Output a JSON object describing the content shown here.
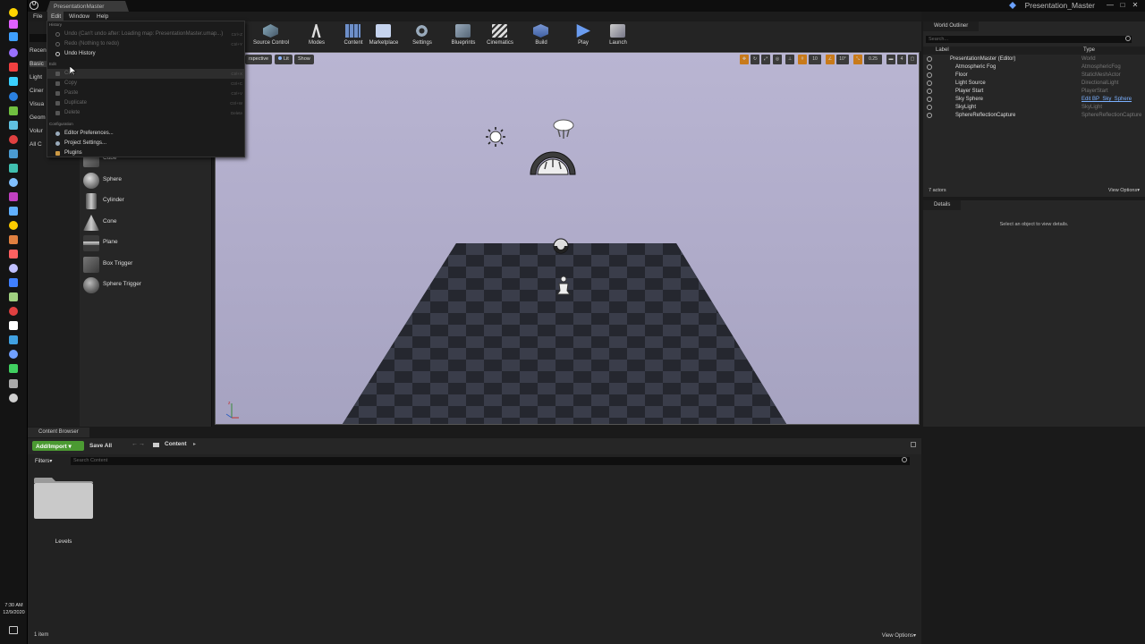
{
  "taskbar": {
    "time": "7:30 AM",
    "date": "12/9/2020",
    "icons": [
      "#ffd400",
      "#e060ff",
      "#3fa0ff",
      "#9a70ff",
      "#f04040",
      "#3ad0ff",
      "#2a80e0",
      "#70c040",
      "#60c0e0",
      "#e04040",
      "#4a9ad0",
      "#40c0b0",
      "#80c0ff",
      "#c040c0",
      "#60b0ff",
      "#ffcc00",
      "#e08040",
      "#ff6060",
      "#c0c0ff",
      "#4080ff",
      "#a0d080",
      "#e04040",
      "#ffffff",
      "#40a0e0",
      "#70a0ff",
      "#40d060",
      "#aaaaaa",
      "#d0d0d0"
    ]
  },
  "title_bar": {
    "document_tab": "PresentationMaster",
    "window_title": "Presentation_Master",
    "min": "—",
    "max": "□",
    "close": "✕"
  },
  "menu": {
    "file": "File",
    "edit": "Edit",
    "window": "Window",
    "help": "Help"
  },
  "edit_menu": {
    "history_header": "History",
    "undo": "Undo (Can't undo after: Loading map: PresentationMaster.umap...)",
    "undo_key": "Ctrl+Z",
    "redo": "Redo (Nothing to redo)",
    "redo_key": "Ctrl+Y",
    "undo_history": "Undo History",
    "edit_header": "Edit",
    "cut": "Cut",
    "cut_key": "Ctrl+X",
    "copy": "Copy",
    "copy_key": "Ctrl+C",
    "paste": "Paste",
    "paste_key": "Ctrl+V",
    "duplicate": "Duplicate",
    "duplicate_key": "Ctrl+W",
    "delete": "Delete",
    "delete_key": "Delete",
    "config_header": "Configuration",
    "editor_prefs": "Editor Preferences...",
    "project_settings": "Project Settings...",
    "plugins": "Plugins"
  },
  "modes_panel": {
    "categories": [
      "Recen",
      "Basic",
      "Light",
      "Ciner",
      "Visua",
      "Geom",
      "Volur",
      "All C"
    ],
    "assets": [
      "Cube",
      "Sphere",
      "Cylinder",
      "Cone",
      "Plane",
      "Box Trigger",
      "Sphere Trigger"
    ]
  },
  "toolbar": {
    "source_control": "Source Control",
    "modes": "Modes",
    "content": "Content",
    "marketplace": "Marketplace",
    "settings": "Settings",
    "blueprints": "Blueprints",
    "cinematics": "Cinematics",
    "build": "Build",
    "play": "Play",
    "launch": "Launch"
  },
  "viewport": {
    "perspective": "rspective",
    "lit": "Lit",
    "show": "Show",
    "grid_snap": "10",
    "rot_snap": "10°",
    "scale_snap": "0.25",
    "cam_speed": "4"
  },
  "world_outliner": {
    "tab": "World Outliner",
    "search_placeholder": "Search...",
    "col_label": "Label",
    "col_type": "Type",
    "rows": [
      {
        "label": "PresentationMaster (Editor)",
        "type": "World"
      },
      {
        "label": "Atmospheric Fog",
        "type": "AtmosphericFog"
      },
      {
        "label": "Floor",
        "type": "StaticMeshActor"
      },
      {
        "label": "Light Source",
        "type": "DirectionalLight"
      },
      {
        "label": "Player Start",
        "type": "PlayerStart"
      },
      {
        "label": "Sky Sphere",
        "type": "Edit BP_Sky_Sphere"
      },
      {
        "label": "SkyLight",
        "type": "SkyLight"
      },
      {
        "label": "SphereReflectionCapture",
        "type": "SphereReflectionCapture"
      }
    ],
    "actor_count": "7 actors",
    "view_options": "View Options▾"
  },
  "details": {
    "tab": "Details",
    "empty_message": "Select an object to view details."
  },
  "content_browser": {
    "tab": "Content Browser",
    "add_import": "Add/Import ▾",
    "save_all": "Save All",
    "path": "Content",
    "filters": "Filters▾",
    "search_placeholder": "Search Content",
    "folder_name": "Levels",
    "item_count": "1 item",
    "view_options": "View Options▾"
  }
}
